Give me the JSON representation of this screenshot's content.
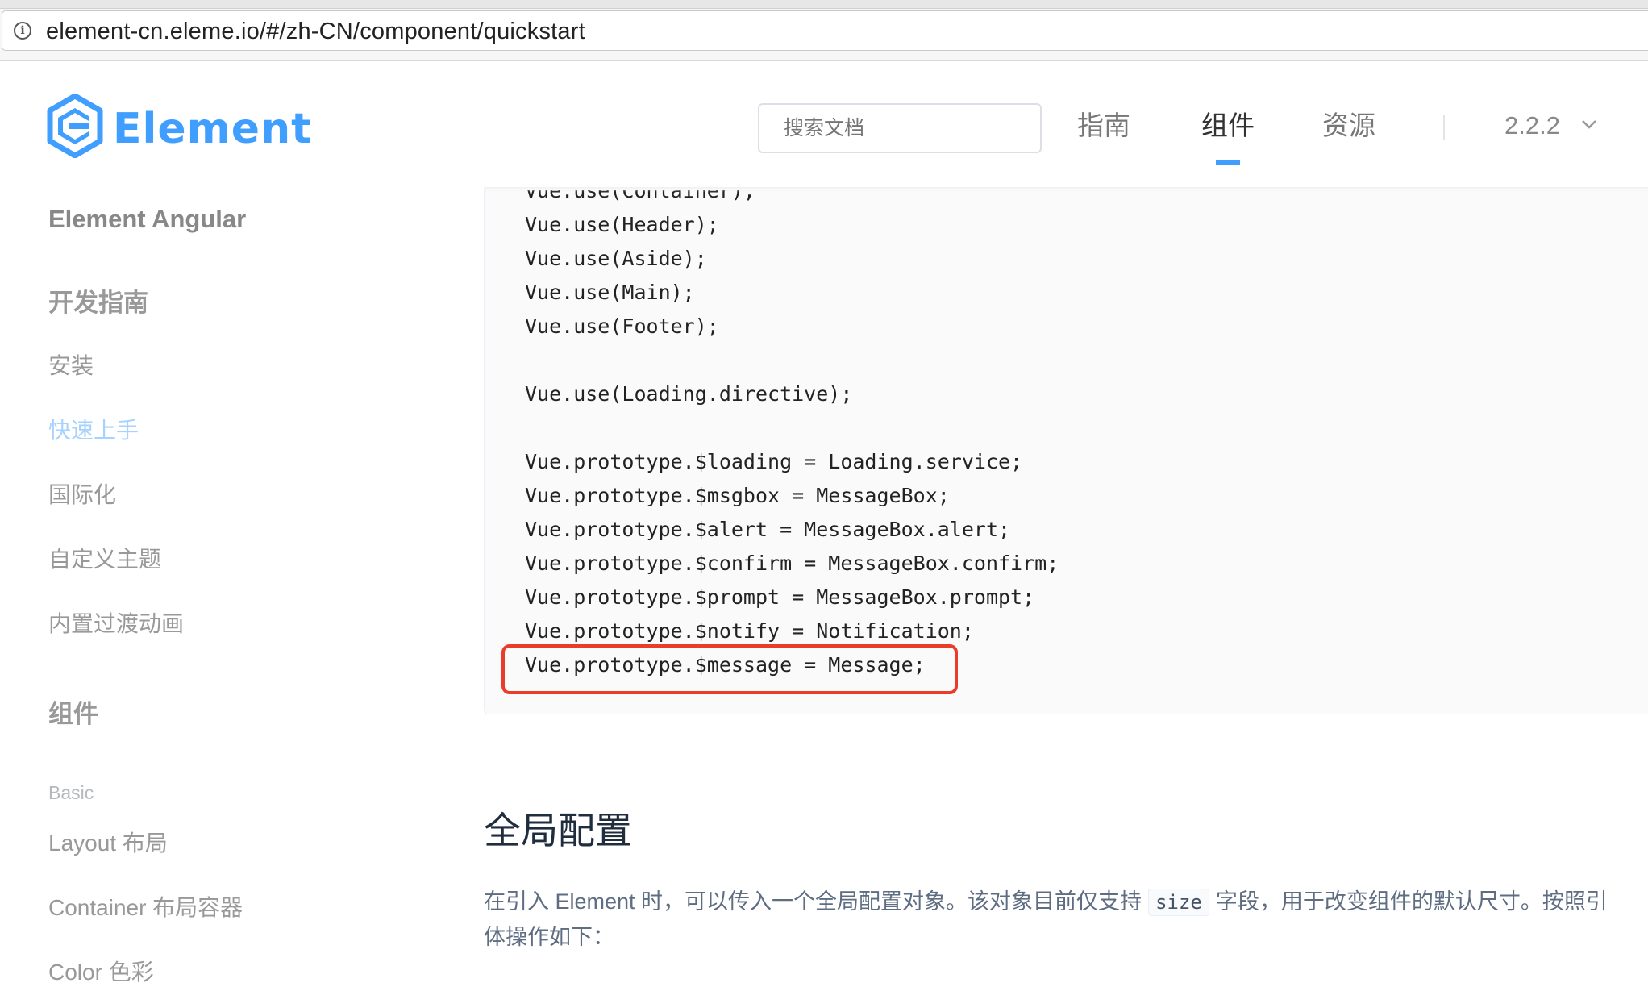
{
  "browser": {
    "url": "element-cn.eleme.io/#/zh-CN/component/quickstart"
  },
  "header": {
    "logo_text": "Element",
    "search_placeholder": "搜索文档",
    "nav": [
      "指南",
      "组件",
      "资源"
    ],
    "active_nav": "组件",
    "version": "2.2.2"
  },
  "sidebar": {
    "angular_link": "Element Angular",
    "group_dev": "开发指南",
    "dev_items": [
      "安装",
      "快速上手",
      "国际化",
      "自定义主题",
      "内置过渡动画"
    ],
    "active_item": "快速上手",
    "group_components": "组件",
    "basic_label": "Basic",
    "component_items": [
      "Layout 布局",
      "Container 布局容器",
      "Color 色彩"
    ]
  },
  "code": {
    "lines": [
      "Vue.use(Container);",
      "Vue.use(Header);",
      "Vue.use(Aside);",
      "Vue.use(Main);",
      "Vue.use(Footer);",
      "",
      "Vue.use(Loading.directive);",
      "",
      "Vue.prototype.$loading = Loading.service;",
      "Vue.prototype.$msgbox = MessageBox;",
      "Vue.prototype.$alert = MessageBox.alert;",
      "Vue.prototype.$confirm = MessageBox.confirm;",
      "Vue.prototype.$prompt = MessageBox.prompt;",
      "Vue.prototype.$notify = Notification;",
      "Vue.prototype.$message = Message;"
    ],
    "highlighted_line": "Vue.prototype.$message = Message;"
  },
  "section": {
    "title": "全局配置",
    "para_before": "在引入 Element 时，可以传入一个全局配置对象。该对象目前仅支持",
    "para_code": "size",
    "para_after": "字段，用于改变组件的默认尺寸。按照引",
    "para_line2": "体操作如下："
  },
  "colors": {
    "brand": "#409eff",
    "highlight_border": "#e93c2a"
  }
}
